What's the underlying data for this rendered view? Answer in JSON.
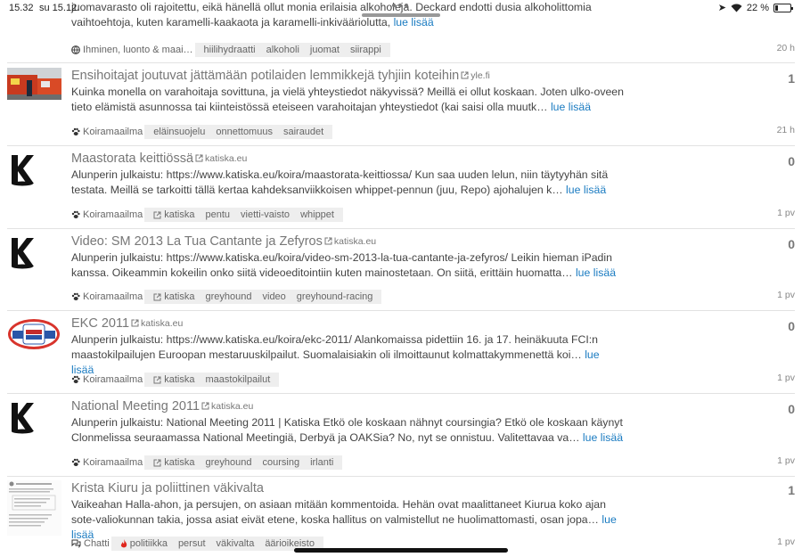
{
  "status": {
    "time": "15.32",
    "date": "su 15.12.",
    "battery": "22 %"
  },
  "items": [
    {
      "title": "",
      "domain": "",
      "excerpt": "juomavarasto oli rajoitettu, eikä hänellä ollut monia erilaisia alkoholeja. Deckard endotti dusia alkoholittomia vaihtoehtoja, kuten karamelli-kaakaota ja karamelli-inkiväärioluttа,",
      "more": "lue lisää",
      "category": "Ihminen, luonto & maai…",
      "tags": [
        "hiilihydraatti",
        "alkoholi",
        "juomat",
        "siirappi"
      ],
      "count": "",
      "age": "20 h"
    },
    {
      "title": "Ensihoitajat joutuvat jättämään potilaiden lemmikkejä tyhjiin koteihin",
      "domain": "yle.fi",
      "excerpt": "Kuinka monella on varahoitaja sovittuna, ja vielä yhteystiedot näkyvissä? Meillä ei ollut koskaan. Joten ulko-oveen tieto elämistä asunnossa tai kiinteistössä eteiseen varahoitajan yhteystiedot (kai saisi olla muutk…",
      "more": "lue lisää",
      "category": "Koiramaailma",
      "tags": [
        "eläinsuojelu",
        "onnettomuus",
        "sairaudet"
      ],
      "count": "1",
      "age": "21 h"
    },
    {
      "title": "Maastorata keittiössä",
      "domain": "katiska.eu",
      "excerpt": "Alunperin julkaistu: https://www.katiska.eu/koira/maastorata-keittiossa/ Kun saa uuden lelun, niin täytyyhän sitä testata. Meillä se tarkoitti tällä kertaa kahdeksanviikkoisen whippet-pennun (juu, Repo) ajohalujen k…",
      "more": "lue lisää",
      "category": "Koiramaailma",
      "tags": [
        "katiska",
        "pentu",
        "vietti-vaisto",
        "whippet"
      ],
      "count": "0",
      "age": "1 pv"
    },
    {
      "title": "Video: SM 2013 La Tua Cantante ja Zefyros",
      "domain": "katiska.eu",
      "excerpt": "Alunperin julkaistu: https://www.katiska.eu/koira/video-sm-2013-la-tua-cantante-ja-zefyros/ Leikin hieman iPadin kanssa. Oikeammin kokeilin onko siitä videoeditointiin kuten mainostetaan. On siitä, erittäin huomatta…",
      "more": "lue lisää",
      "category": "Koiramaailma",
      "tags": [
        "katiska",
        "greyhound",
        "video",
        "greyhound-racing"
      ],
      "count": "0",
      "age": "1 pv"
    },
    {
      "title": "EKC 2011",
      "domain": "katiska.eu",
      "excerpt": "Alunperin julkaistu: https://www.katiska.eu/koira/ekc-2011/ Alankomaissa pidettiin 16. ja 17. heinäkuuta FCI:n maastokilpailujen Euroopan mestaruuskilpailut. Suomalaisiakin oli ilmoittaunut kolmattakymmenettä koi…",
      "more": "lue lisää",
      "category": "Koiramaailma",
      "tags": [
        "katiska",
        "maastokilpailut"
      ],
      "count": "0",
      "age": "1 pv"
    },
    {
      "title": "National Meeting 2011",
      "domain": "katiska.eu",
      "excerpt": "Alunperin julkaistu: National Meeting 2011 | Katiska Etkö ole koskaan nähnyt coursingia? Etkö ole koskaan käynyt Clonmelissa seuraamassa National Meetingiä, Derbyä ja OAKSia? No, nyt se onnistuu. Valitettavaa va…",
      "more": "lue lisää",
      "category": "Koiramaailma",
      "tags": [
        "katiska",
        "greyhound",
        "coursing",
        "irlanti"
      ],
      "count": "0",
      "age": "1 pv"
    },
    {
      "title": "Krista Kiuru ja poliittinen väkivalta",
      "domain": "",
      "excerpt": "Vaikeahan Halla-ahon, ja persujen, on asiaan mitään kommentoida. Hehän ovat maalittaneet Kiurua koko ajan sote-valiokunnan takia, jossa asiat eivät etene, koska hallitus on valmistellut ne huolimattomasti, osan jopa…",
      "more": "lue lisää",
      "category": "Chatti",
      "tags": [
        "politiikka",
        "persut",
        "väkivalta",
        "äärioikeisto"
      ],
      "count": "1",
      "age": "1 pv"
    }
  ]
}
